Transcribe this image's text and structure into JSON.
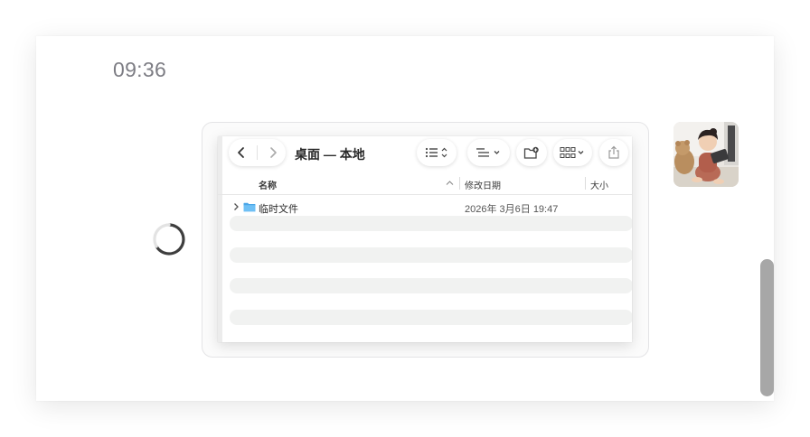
{
  "chat": {
    "timestamp": "09:36"
  },
  "finder": {
    "title": "桌面 — 本地",
    "columns": {
      "name": "名称",
      "date": "修改日期",
      "size": "大小"
    },
    "rows": [
      {
        "name": "临时文件",
        "date": "2026年 3月6日 19:47",
        "type": "folder"
      }
    ],
    "icons": [
      "back-icon",
      "forward-icon",
      "list-view-icon",
      "group-icon",
      "new-folder-icon",
      "grid-view-icon",
      "share-icon",
      "sort-ascending-icon",
      "disclosure-chevron-icon",
      "folder-icon"
    ]
  },
  "colors": {
    "folder_blue": "#5bb4f0",
    "stripe": "#f1f2f1",
    "timestamp": "#7d7d84",
    "scrollbar": "#a7a7a7"
  }
}
